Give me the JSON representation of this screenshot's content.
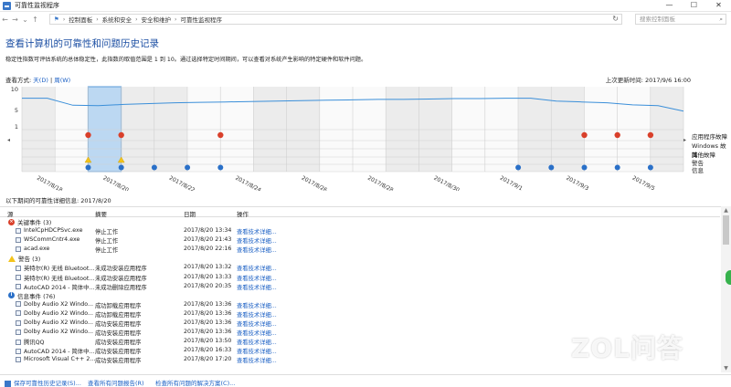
{
  "window": {
    "title": "可靠性监视程序",
    "controls": [
      "—",
      "☐",
      "✕"
    ]
  },
  "address": {
    "crumbs": [
      "控制面板",
      "系统和安全",
      "安全和维护",
      "可靠性监视程序"
    ],
    "search_placeholder": "搜索控制面板"
  },
  "page": {
    "title": "查看计算机的可靠性和问题历史记录",
    "description": "稳定性指数可评估系统的总体稳定性，此指数的取值范围是 1 到 10。通过选择特定时间期间，可以查看对系统产生影响的特定硬件和软件问题。",
    "view_by_label": "查看方式:",
    "view_day": "天(D)",
    "view_sep": "|",
    "view_week": "周(W)",
    "last_updated": "上次更新时间: 2017/9/6 16:00"
  },
  "chart_data": {
    "type": "line",
    "y_ticks": [
      "10",
      "5",
      "1"
    ],
    "x_tick_labels": [
      "2017/8/18",
      "2017/8/20",
      "2017/8/22",
      "2017/8/24",
      "2017/8/26",
      "2017/8/28",
      "2017/8/30",
      "2017/9/1",
      "2017/9/3",
      "2017/9/5"
    ],
    "stability_index": [
      7.9,
      7.9,
      6.2,
      6.1,
      6.4,
      6.6,
      6.8,
      6.9,
      7.0,
      7.1,
      7.2,
      7.3,
      7.4,
      7.5,
      7.6,
      7.6,
      7.7,
      7.8,
      7.8,
      7.9,
      7.9,
      7.2,
      7.0,
      6.8,
      6.3,
      6.1,
      4.8
    ],
    "selected_day_index": 2,
    "row_labels": [
      "应用程序故障",
      "Windows 故障",
      "其他故障",
      "警告",
      "信息"
    ],
    "app_failure_days": [
      2,
      3,
      6,
      17,
      18,
      19
    ],
    "warning_days": [
      2,
      3
    ],
    "info_days": [
      2,
      3,
      4,
      5,
      6,
      15,
      16,
      17,
      18,
      19
    ]
  },
  "details": {
    "header": "以下期间的可靠性详细信息: 2017/8/20",
    "columns": [
      "源",
      "摘要",
      "日期",
      "操作"
    ],
    "groups": [
      {
        "type": "err",
        "label": "关键事件 (3)",
        "rows": [
          {
            "src": "IntelCpHDCPSvc.exe",
            "sum": "停止工作",
            "date": "2017/8/20 13:34",
            "op": "查看技术详细..."
          },
          {
            "src": "WSCommCntr4.exe",
            "sum": "停止工作",
            "date": "2017/8/20 21:43",
            "op": "查看技术详细..."
          },
          {
            "src": "acad.exe",
            "sum": "停止工作",
            "date": "2017/8/20 22:16",
            "op": "查看技术详细..."
          }
        ]
      },
      {
        "type": "warn",
        "label": "警告 (3)",
        "rows": [
          {
            "src": "英特尔(R) 无线 Bluetoot...",
            "sum": "未成功安装应用程序",
            "date": "2017/8/20 13:32",
            "op": "查看技术详细..."
          },
          {
            "src": "英特尔(R) 无线 Bluetoot...",
            "sum": "未成功安装应用程序",
            "date": "2017/8/20 13:33",
            "op": "查看技术详细..."
          },
          {
            "src": "AutoCAD 2014 - 简体中...",
            "sum": "未成功删除应用程序",
            "date": "2017/8/20 20:35",
            "op": "查看技术详细..."
          }
        ]
      },
      {
        "type": "info",
        "label": "信息事件 (76)",
        "rows": [
          {
            "src": "Dolby Audio X2 Windo...",
            "sum": "成功卸载应用程序",
            "date": "2017/8/20 13:36",
            "op": "查看技术详细..."
          },
          {
            "src": "Dolby Audio X2 Windo...",
            "sum": "成功卸载应用程序",
            "date": "2017/8/20 13:36",
            "op": "查看技术详细..."
          },
          {
            "src": "Dolby Audio X2 Windo...",
            "sum": "成功安装应用程序",
            "date": "2017/8/20 13:36",
            "op": "查看技术详细..."
          },
          {
            "src": "Dolby Audio X2 Windo...",
            "sum": "成功安装应用程序",
            "date": "2017/8/20 13:36",
            "op": "查看技术详细..."
          },
          {
            "src": "腾讯QQ",
            "sum": "成功安装应用程序",
            "date": "2017/8/20 13:50",
            "op": "查看技术详细..."
          },
          {
            "src": "AutoCAD 2014 - 简体中...",
            "sum": "成功安装应用程序",
            "date": "2017/8/20 16:33",
            "op": "查看技术详细..."
          },
          {
            "src": "Microsoft Visual C++ 2...",
            "sum": "成功安装应用程序",
            "date": "2017/8/20 17:20",
            "op": "查看技术详细..."
          }
        ]
      }
    ]
  },
  "footer": {
    "save": "保存可靠性历史记录(S)...",
    "view_all": "查看所有问题报告(R)",
    "check_solutions": "检查所有问题的解决方案(C)..."
  },
  "watermark": "ZOL问答"
}
